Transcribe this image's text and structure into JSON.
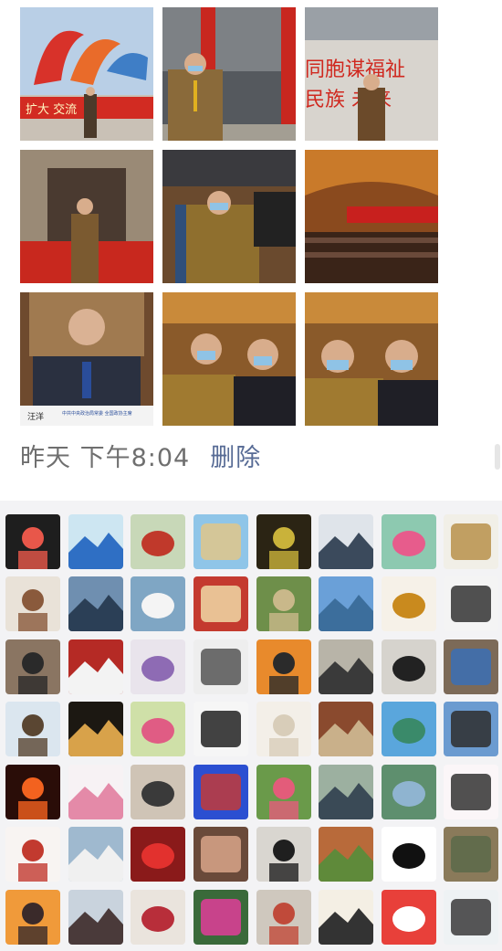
{
  "moment": {
    "photos": [
      {
        "id": "photo-1",
        "icon": "banner-stage-photo",
        "banner_text": "扩大 交流"
      },
      {
        "id": "photo-2",
        "icon": "man-red-pillars-photo"
      },
      {
        "id": "photo-3",
        "icon": "man-slogan-wall-photo",
        "wall_line1": "同胞谋福祉",
        "wall_line2": "民族 未来"
      },
      {
        "id": "photo-4",
        "icon": "man-corridor-photo"
      },
      {
        "id": "photo-5",
        "icon": "man-seated-hall-photo"
      },
      {
        "id": "photo-6",
        "icon": "auditorium-photo"
      },
      {
        "id": "photo-7",
        "icon": "speaker-broadcast-photo",
        "caption_name": "汪洋",
        "caption_title": "中共中央政治局常委 全国政协主席"
      },
      {
        "id": "photo-8",
        "icon": "two-men-selfie-photo"
      },
      {
        "id": "photo-9",
        "icon": "two-men-selfie-photo-2"
      }
    ],
    "time_label": "昨天 下午8:04",
    "delete_label": "删除"
  },
  "likes": {
    "avatars": [
      {
        "icon": "banner-man-avatar",
        "bg": "#7a4b2e",
        "fg": "#d9a441"
      },
      {
        "icon": "blue-lotus-avatar",
        "bg": "#cde6f2",
        "fg": "#2f6fc4"
      },
      {
        "icon": "woman-red-dress-avatar",
        "bg": "#c8d8b8",
        "fg": "#c0392b"
      },
      {
        "icon": "beach-avatar",
        "bg": "#8fc5e8",
        "fg": "#e0c68a"
      },
      {
        "icon": "dark-pattern-avatar",
        "bg": "#2b2414",
        "fg": "#c9b23a"
      },
      {
        "icon": "two-men-avatar",
        "bg": "#dfe4ea",
        "fg": "#3b4a5c"
      },
      {
        "icon": "pink-lotus-avatar",
        "bg": "#8dc9b0",
        "fg": "#e75c8c"
      },
      {
        "icon": "coin-product-avatar",
        "bg": "#f1efe7",
        "fg": "#b8904a"
      },
      {
        "icon": "woman-portrait-avatar",
        "bg": "#e9e2d8",
        "fg": "#8a5a3c"
      },
      {
        "icon": "mountains-avatar",
        "bg": "#6f8fb0",
        "fg": "#2b3f56"
      },
      {
        "icon": "teacup-avatar",
        "bg": "#7fa6c4",
        "fg": "#f4f4f4"
      },
      {
        "icon": "certificate-avatar",
        "bg": "#c43a2f",
        "fg": "#f0d9a6"
      },
      {
        "icon": "great-wall-avatar",
        "bg": "#6e8f4a",
        "fg": "#c9b88a"
      },
      {
        "icon": "city-river-avatar",
        "bg": "#6aa0d8",
        "fg": "#3c6e9c"
      },
      {
        "icon": "phoenix-avatar",
        "bg": "#f6f1e8",
        "fg": "#c98a1e"
      },
      {
        "icon": "cartoon-man-avatar",
        "bg": "#f4f4f4",
        "fg": "#333333"
      },
      {
        "icon": "man-sofa-avatar",
        "bg": "#8a7562",
        "fg": "#2a2a2a"
      },
      {
        "icon": "bank-sign-avatar",
        "bg": "#b52a25",
        "fg": "#f3f3f3"
      },
      {
        "icon": "purple-flowers-avatar",
        "bg": "#e9e4ec",
        "fg": "#8e6bb4"
      },
      {
        "icon": "ink-sketch-avatar",
        "bg": "#eeeeee",
        "fg": "#555555"
      },
      {
        "icon": "tiger-art-avatar",
        "bg": "#e88a2c",
        "fg": "#2b2b2b"
      },
      {
        "icon": "man-bridge-avatar",
        "bg": "#b8b4a8",
        "fg": "#3a3a3a"
      },
      {
        "icon": "man-dark-shirt-avatar",
        "bg": "#d6d3cd",
        "fg": "#222222"
      },
      {
        "icon": "man-speaking-avatar",
        "bg": "#7c6a58",
        "fg": "#3b6fb5"
      },
      {
        "icon": "pagoda-avatar",
        "bg": "#dbe6ef",
        "fg": "#5a4632"
      },
      {
        "icon": "night-street-avatar",
        "bg": "#1c1812",
        "fg": "#d8a24a"
      },
      {
        "icon": "pink-rose-avatar",
        "bg": "#cfe0a8",
        "fg": "#e05c84"
      },
      {
        "icon": "caricature-avatar",
        "bg": "#f6f6f6",
        "fg": "#222222"
      },
      {
        "icon": "white-deer-avatar",
        "bg": "#f3efe8",
        "fg": "#d8cdb9"
      },
      {
        "icon": "man-office-avatar",
        "bg": "#8a4a2e",
        "fg": "#c9b08a"
      },
      {
        "icon": "coast-avatar",
        "bg": "#5aa6dc",
        "fg": "#3a8a6a"
      },
      {
        "icon": "eagle-avatar",
        "bg": "#6b9bd0",
        "fg": "#2e2e2e"
      },
      {
        "icon": "fire-horse-avatar",
        "bg": "#2a0d08",
        "fg": "#f2621f"
      },
      {
        "icon": "bunny-girl-avatar",
        "bg": "#f7f2f4",
        "fg": "#e48aa8"
      },
      {
        "icon": "glasses-man-avatar",
        "bg": "#cfc4b6",
        "fg": "#3a3a3a"
      },
      {
        "icon": "blue-wall-woman-avatar",
        "bg": "#2b4fd1",
        "fg": "#c23a3a"
      },
      {
        "icon": "garden-avatar",
        "bg": "#6a9a4a",
        "fg": "#e35c7a"
      },
      {
        "icon": "man-trees-avatar",
        "bg": "#9cb0a0",
        "fg": "#3a4a56"
      },
      {
        "icon": "lake-avatar",
        "bg": "#5e8f6e",
        "fg": "#8fb4d0"
      },
      {
        "icon": "cartoon-rabbit-avatar",
        "bg": "#fbf6f8",
        "fg": "#333333"
      },
      {
        "icon": "calligraphy-red-avatar",
        "bg": "#f8f4f2",
        "fg": "#c23a2f"
      },
      {
        "icon": "fountain-avatar",
        "bg": "#9fb9cf",
        "fg": "#f0f0f0"
      },
      {
        "icon": "red-peony-avatar",
        "bg": "#8a1a1a",
        "fg": "#e2312e"
      },
      {
        "icon": "woman-short-hair-avatar",
        "bg": "#6a4a3a",
        "fg": "#d8a48a"
      },
      {
        "icon": "man-dark-jacket-avatar",
        "bg": "#d9d6d0",
        "fg": "#1f1f1f"
      },
      {
        "icon": "autumn-garden-avatar",
        "bg": "#b86a3a",
        "fg": "#5f8a3a"
      },
      {
        "icon": "calligraphy-black-avatar",
        "bg": "#ffffff",
        "fg": "#111111"
      },
      {
        "icon": "man-bench-avatar",
        "bg": "#8a7a5a",
        "fg": "#5a6a4a"
      },
      {
        "icon": "sunset-avatar",
        "bg": "#f09a3a",
        "fg": "#3a2a2a"
      },
      {
        "icon": "elderly-woman-avatar",
        "bg": "#c9d3dd",
        "fg": "#4a3a3a"
      },
      {
        "icon": "woman-selfie-avatar",
        "bg": "#eae4dd",
        "fg": "#b82e3a"
      },
      {
        "icon": "pink-peony-avatar",
        "bg": "#3a6a3a",
        "fg": "#e23c9a"
      },
      {
        "icon": "man-dragon-art-avatar",
        "bg": "#cfc8be",
        "fg": "#c04a3a"
      },
      {
        "icon": "calligraphy-scroll-avatar",
        "bg": "#f4efe4",
        "fg": "#333333"
      },
      {
        "icon": "red-mascot-avatar",
        "bg": "#e8403a",
        "fg": "#ffffff"
      },
      {
        "icon": "drawn-woman-avatar",
        "bg": "#eef2f4",
        "fg": "#3a3a3a"
      },
      {
        "icon": "chalkboard-2020-avatar",
        "bg": "#1e1e1e",
        "fg": "#e8574a"
      }
    ]
  }
}
